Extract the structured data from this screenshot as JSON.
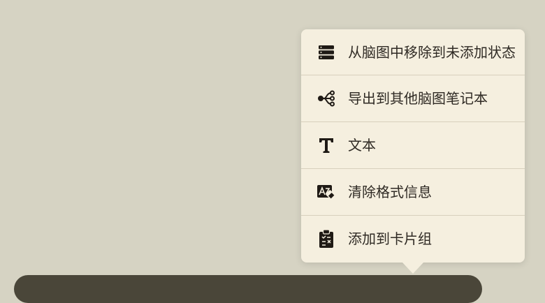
{
  "context_menu": {
    "items": [
      {
        "label": "从脑图中移除到未添加状态",
        "icon": "list-stack-icon"
      },
      {
        "label": "导出到其他脑图笔记本",
        "icon": "share-nodes-icon"
      },
      {
        "label": "文本",
        "icon": "text-format-icon"
      },
      {
        "label": "清除格式信息",
        "icon": "clear-format-icon"
      },
      {
        "label": "添加到卡片组",
        "icon": "clipboard-list-icon"
      }
    ]
  },
  "colors": {
    "background": "#d6d3c3",
    "menu_background": "#f5efdf",
    "menu_divider": "#d8d0bd",
    "text": "#2f2a24",
    "toolbar": "#4a4639"
  }
}
